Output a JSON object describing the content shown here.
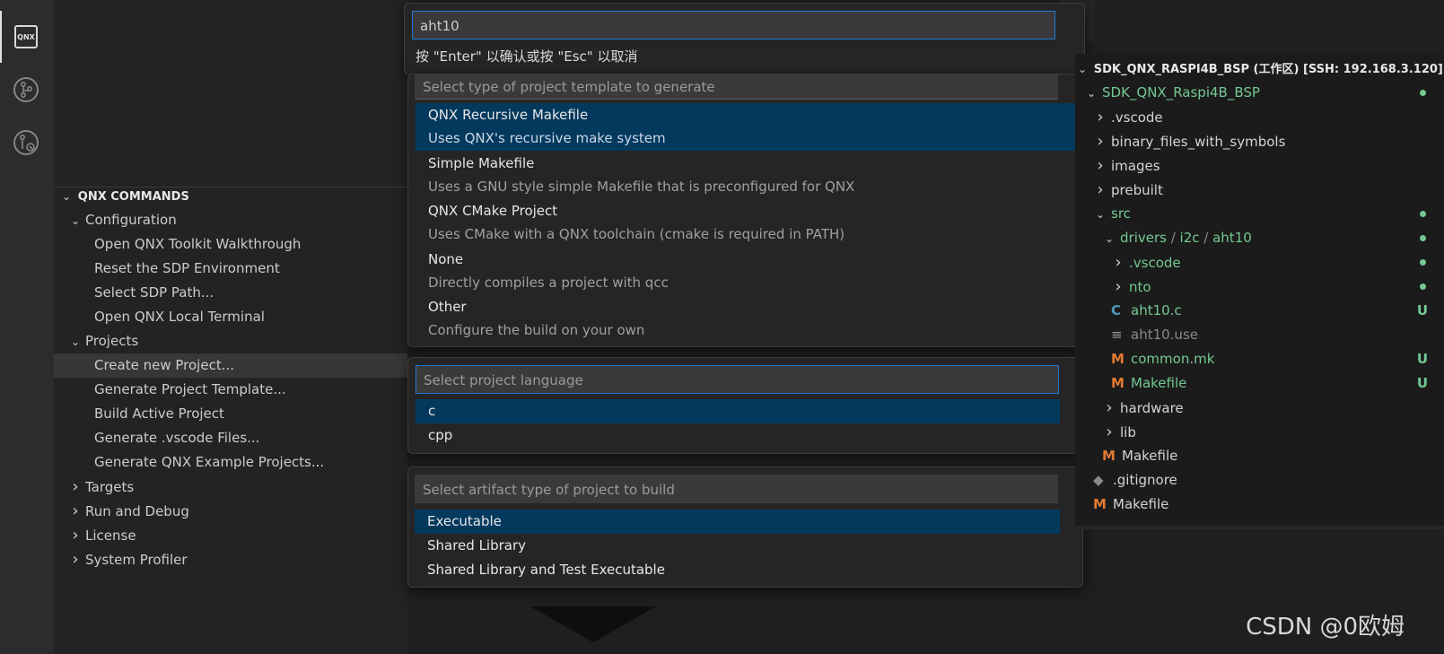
{
  "activity_bar": {
    "icons": [
      "qnx-icon",
      "source-control-icon",
      "git-graph-icon"
    ],
    "qnx_label": "QNX"
  },
  "sidebar": {
    "section_title": "QNX COMMANDS",
    "groups": [
      {
        "label": "Configuration",
        "expanded": true,
        "items": [
          "Open QNX Toolkit Walkthrough",
          "Reset the SDP Environment",
          "Select SDP Path...",
          "Open QNX Local Terminal"
        ]
      },
      {
        "label": "Projects",
        "expanded": true,
        "items": [
          "Create new Project...",
          "Generate Project Template...",
          "Build Active Project",
          "Generate .vscode Files...",
          "Generate QNX Example Projects..."
        ]
      },
      {
        "label": "Targets",
        "expanded": false,
        "items": []
      },
      {
        "label": "Run and Debug",
        "expanded": false,
        "items": []
      },
      {
        "label": "License",
        "expanded": false,
        "items": []
      },
      {
        "label": "System Profiler",
        "expanded": false,
        "items": []
      }
    ],
    "selected_item": "Create new Project..."
  },
  "quickpick_name": {
    "value": "aht10",
    "hint": "按 \"Enter\" 以确认或按 \"Esc\" 以取消"
  },
  "quickpick_template": {
    "placeholder": "Select type of project template to generate",
    "options": [
      {
        "title": "QNX Recursive Makefile",
        "desc": "Uses QNX's recursive make system",
        "selected": true
      },
      {
        "title": "Simple Makefile",
        "desc": "Uses a GNU style simple Makefile that is preconfigured for QNX",
        "selected": false
      },
      {
        "title": "QNX CMake Project",
        "desc": "Uses CMake with a QNX toolchain (cmake is required in PATH)",
        "selected": false
      },
      {
        "title": "None",
        "desc": "Directly compiles a project with qcc",
        "selected": false
      },
      {
        "title": "Other",
        "desc": "Configure the build on your own",
        "selected": false
      }
    ]
  },
  "quickpick_language": {
    "placeholder": "Select project language",
    "options": [
      "c",
      "cpp"
    ],
    "selected": "c"
  },
  "quickpick_artifact": {
    "placeholder": "Select artifact type of project to build",
    "options": [
      "Executable",
      "Shared Library",
      "Shared Library and Test Executable"
    ],
    "selected": "Executable"
  },
  "explorer": {
    "workspace_title": "SDK_QNX_RASPI4B_BSP (工作区) [SSH: 192.168.3.120]",
    "rows": [
      {
        "label": "SDK_QNX_Raspi4B_BSP",
        "indent": 0,
        "kind": "folder-open",
        "green": true,
        "status": "dot"
      },
      {
        "label": ".vscode",
        "indent": 1,
        "kind": "folder",
        "green": false,
        "status": ""
      },
      {
        "label": "binary_files_with_symbols",
        "indent": 1,
        "kind": "folder",
        "green": false,
        "status": ""
      },
      {
        "label": "images",
        "indent": 1,
        "kind": "folder",
        "green": false,
        "status": ""
      },
      {
        "label": "prebuilt",
        "indent": 1,
        "kind": "folder",
        "green": false,
        "status": ""
      },
      {
        "label": "src",
        "indent": 1,
        "kind": "folder-open",
        "green": true,
        "status": "dot"
      },
      {
        "label": "drivers",
        "path_rest": [
          "i2c",
          "aht10"
        ],
        "indent": 2,
        "kind": "folder-open",
        "green": true,
        "status": "dot"
      },
      {
        "label": ".vscode",
        "indent": 3,
        "kind": "folder",
        "green": true,
        "status": "dot"
      },
      {
        "label": "nto",
        "indent": 3,
        "kind": "folder",
        "green": true,
        "status": "dot"
      },
      {
        "label": "aht10.c",
        "indent": 3,
        "kind": "c-file",
        "green": true,
        "status": "U"
      },
      {
        "label": "aht10.use",
        "indent": 3,
        "kind": "text-file",
        "green": false,
        "grey": true,
        "status": ""
      },
      {
        "label": "common.mk",
        "indent": 3,
        "kind": "m-file",
        "green": true,
        "status": "U"
      },
      {
        "label": "Makefile",
        "indent": 3,
        "kind": "m-file",
        "green": true,
        "status": "U"
      },
      {
        "label": "hardware",
        "indent": 2,
        "kind": "folder",
        "green": false,
        "status": ""
      },
      {
        "label": "lib",
        "indent": 2,
        "kind": "folder",
        "green": false,
        "status": ""
      },
      {
        "label": "Makefile",
        "indent": 2,
        "kind": "m-file",
        "green": false,
        "status": ""
      },
      {
        "label": ".gitignore",
        "indent": 1,
        "kind": "git-file",
        "green": false,
        "status": ""
      },
      {
        "label": "Makefile",
        "indent": 1,
        "kind": "m-file",
        "green": false,
        "status": ""
      }
    ]
  },
  "watermark": "CSDN @0欧姆"
}
